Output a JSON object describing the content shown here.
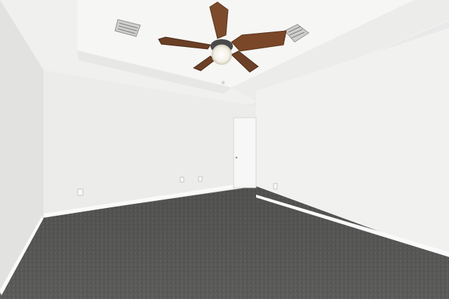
{
  "scene": {
    "subject": "empty-room",
    "palette": {
      "ceiling": "#f1f1f0",
      "ceiling_recess": "#f6f6f5",
      "wall_left": "#e4e4e3",
      "wall_back": "#ededec",
      "wall_right": "#f2f2f1",
      "baseboard": "#fbfbfb",
      "carpet": "#5d5d5c",
      "fan_blade": "#7a4a2c",
      "fan_light": "#f4f1e8",
      "door": "#f7f7f7",
      "vent": "#9a9a9a"
    },
    "icons": [
      "ceiling-fan-icon",
      "air-vent-icon",
      "outlet-icon",
      "door-icon"
    ]
  }
}
